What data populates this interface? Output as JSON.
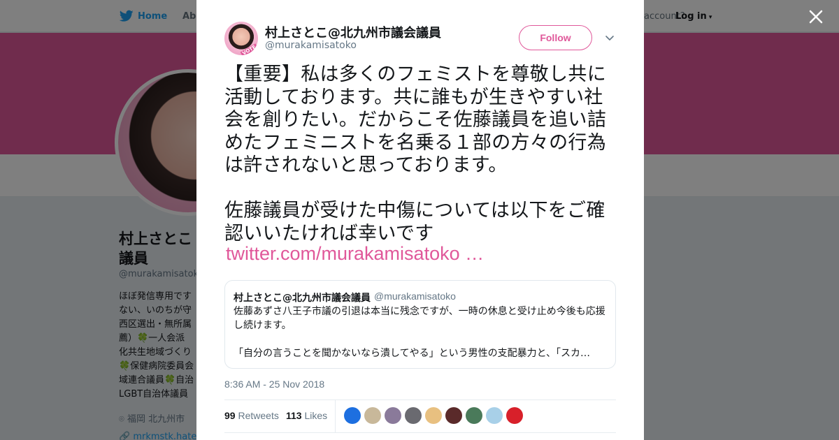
{
  "colors": {
    "accent": "#e0589a",
    "twitter_blue": "#1da1f2",
    "text": "#14171a",
    "muted": "#657786"
  },
  "topnav": {
    "home_label": "Home",
    "about_label": "Abo",
    "account_prompt": "account?",
    "login_label": "Log in"
  },
  "profile_bg": {
    "name": "村上さとこ 議員",
    "handle": "@murakamisatoko",
    "bio": "ほぼ発信専用です\nない、いのちが守\n西区選出・無所属\n薦）🍀一人会派\n化共生地域づくり\n🍀保健病院委員会\n域連合議員🍀自治\nLGBT自治体議員",
    "location": "福岡 北九州市",
    "url": "mrkmstk.hater"
  },
  "tweet": {
    "author_name": "村上さとこ@北九州市議会議員",
    "author_handle": "@murakamisatoko",
    "avatar_badge": "VOTE",
    "follow_label": "Follow",
    "text": "【重要】私は多くのフェミストを尊敬し共に活動しております。共に誰もが生きやすい社会を創りたい。だからこそ佐藤議員を追い詰めたフェミニストを名乗る１部の方々の行為は許されないと思っております。\n\n佐藤議員が受けた中傷については以下をご確認いいたければ幸いです",
    "link_text": "twitter.com/murakamisatoko …",
    "quote": {
      "name": "村上さとこ@北九州市議会議員",
      "handle": "@murakamisatoko",
      "text": "佐藤あずさ八王子市議の引退は本当に残念ですが、一時の休息と受け止め今後も応援し続けます。\n\n「自分の言うことを聞かないなら潰してやる」という男性の支配暴力と、「スカ…"
    },
    "timestamp": "8:36 AM - 25 Nov 2018",
    "retweets_count": "99",
    "retweets_label": "Retweets",
    "likes_count": "113",
    "likes_label": "Likes"
  },
  "likers": [
    {
      "icon": "avatar-blue",
      "color": "#1d6fe0"
    },
    {
      "icon": "avatar-cartoon",
      "color": "#c8b89a"
    },
    {
      "icon": "avatar-anime",
      "color": "#8a7a9a"
    },
    {
      "icon": "avatar-gray",
      "color": "#6a6a70"
    },
    {
      "icon": "avatar-heart",
      "color": "#e8c080"
    },
    {
      "icon": "avatar-dark",
      "color": "#5a2a2a"
    },
    {
      "icon": "avatar-landscape",
      "color": "#4a7a5a"
    },
    {
      "icon": "avatar-bird",
      "color": "#a8d0e8"
    },
    {
      "icon": "avatar-red",
      "color": "#d8202a"
    }
  ]
}
